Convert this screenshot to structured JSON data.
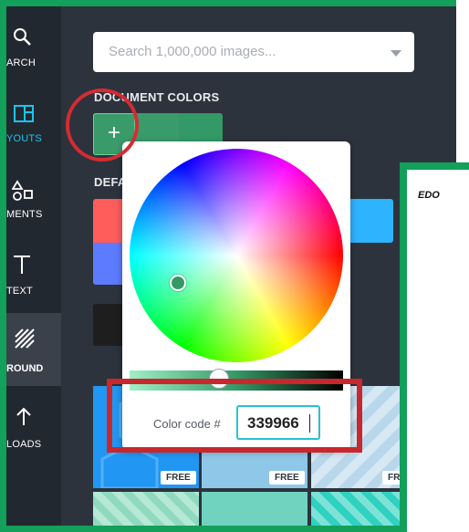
{
  "nav": {
    "items": [
      {
        "label": "ARCH",
        "icon": "search-icon"
      },
      {
        "label": "YOUTS",
        "icon": "layouts-icon"
      },
      {
        "label": "MENTS",
        "icon": "elements-icon"
      },
      {
        "label": "TEXT",
        "icon": "text-icon"
      },
      {
        "label": "ROUND",
        "icon": "background-icon"
      },
      {
        "label": "LOADS",
        "icon": "upload-icon"
      }
    ]
  },
  "search": {
    "placeholder": "Search 1,000,000 images..."
  },
  "sections": {
    "document_colors": "DOCUMENT COLORS",
    "default_colors": "DEFA"
  },
  "document_colors": {
    "add_label": "+",
    "swatches": [
      "#339966",
      "#3a9b6a"
    ]
  },
  "default_colors": [
    "#ff5c5c",
    "#5d7bff",
    "#1e1e1e",
    "#2eb3ff"
  ],
  "picker": {
    "label": "Color code #",
    "value": "339966",
    "selected_color": "#339966",
    "brightness": 0.42
  },
  "backgrounds": {
    "free_label": "FREE"
  },
  "document": {
    "text": "EDO"
  },
  "colors": {
    "accent_green": "#12a05a",
    "highlight_red": "#c8272d",
    "input_border": "#27c1d4"
  }
}
